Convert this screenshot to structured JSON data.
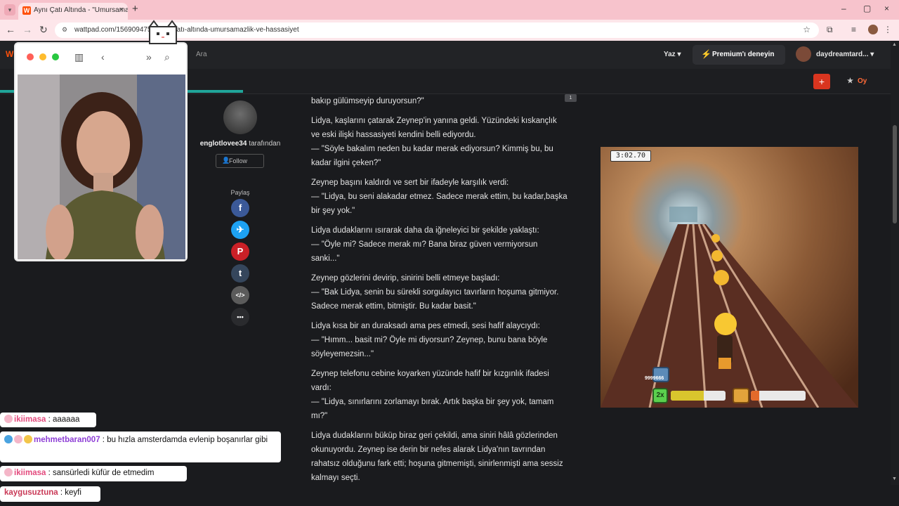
{
  "browser": {
    "tab_title": "Aynı Çatı Altında - \"Umursama",
    "tab_close": "×",
    "new_tab": "+",
    "url": "wattpad.com/1569094754-aynı-çatı-altında-umursamazlik-ve-hassasiyet",
    "window_controls": [
      "–",
      "▢",
      "×"
    ]
  },
  "header": {
    "logo": "W",
    "search_placeholder": "Ara",
    "write_label": "Yaz ▾",
    "premium_label": "Premium'ı deneyin",
    "username": "daydreamtard... ▾"
  },
  "storybar": {
    "add_label": "+",
    "vote_label": "Oy",
    "reading_progress": 0.27
  },
  "author": {
    "name": "englotlovee34",
    "suffix": " tarafından",
    "follow_label": "Follow"
  },
  "share": {
    "label": "Paylaş",
    "buttons": [
      {
        "name": "facebook",
        "glyph": "f",
        "color": "#3b5998"
      },
      {
        "name": "twitter",
        "glyph": "✈",
        "color": "#1da1f2"
      },
      {
        "name": "pinterest",
        "glyph": "P",
        "color": "#cb2027"
      },
      {
        "name": "tumblr",
        "glyph": "t",
        "color": "#35465c"
      },
      {
        "name": "embed",
        "glyph": "</>",
        "color": "#5b5b5b"
      },
      {
        "name": "more",
        "glyph": "•••",
        "color": "#2a2b2e"
      }
    ]
  },
  "story": {
    "comment_count": "1",
    "paragraphs": [
      "bakıp gülümseyip duruyorsun?\"",
      "Lidya, kaşlarını çatarak Zeynep'in yanına geldi. Yüzündeki kıskançlık ve eski ilişki hassasiyeti kendini belli ediyordu.\n— \"Söyle bakalım neden bu kadar merak ediyorsun? Kimmiş bu, bu kadar ilgini çeken?\"",
      "Zeynep başını kaldırdı ve sert bir ifadeyle karşılık verdi:\n— \"Lidya, bu seni alakadar etmez. Sadece merak ettim, bu kadar,başka bir şey yok.\"",
      "Lidya dudaklarını ısırarak daha da iğneleyici bir şekilde yaklaştı:\n— \"Öyle mi? Sadece merak mı? Bana biraz güven vermiyorsun sanki...\"",
      "Zeynep gözlerini devirip, sinirini belli etmeye başladı:\n— \"Bak Lidya, senin bu sürekli sorgulayıcı tavırların hoşuma gitmiyor. Sadece merak ettim, bitmiştir. Bu kadar basit.\"",
      "Lidya kısa bir an duraksadı ama pes etmedi, sesi hafif alaycıydı:\n— \"Hımm... basit mi? Öyle mi diyorsun? Zeynep, bunu bana böyle söyleyemezsin...\"",
      "Zeynep telefonu cebine koyarken yüzünde hafif bir kızgınlık ifadesi vardı:\n— \"Lidya, sınırlarını zorlamayı bırak. Artık başka bir şey yok, tamam mı?\"",
      "Lidya dudaklarını büküp biraz geri çekildi, ama siniri hâlâ gözlerinden okunuyordu. Zeynep ise derin bir nefes alarak Lidya'nın tavrından rahatsız olduğunu fark etti; hoşuna gitmemişti, sinirlenmişti ama sessiz kalmayı seçti."
    ]
  },
  "game": {
    "timer": "3:02.70",
    "score": "9999666",
    "multiplier": "2x",
    "meter1_level": 0.6,
    "meter2_level": 0.15
  },
  "chat": [
    {
      "user": "ikiimasa",
      "text": " : aaaaaa"
    },
    {
      "user": "mehmetbaran007",
      "text": " : bu hızla amsterdamda evlenip boşanırlar gibi"
    },
    {
      "user": "ikiimasa",
      "text": " : sansürledi küfür de etmedim"
    },
    {
      "user": "kaygusuztuna",
      "text": " : keyfi"
    }
  ],
  "colors": {
    "accent": "#ff500a",
    "progress": "#20a59a",
    "premium_icon": "#b45cff"
  }
}
